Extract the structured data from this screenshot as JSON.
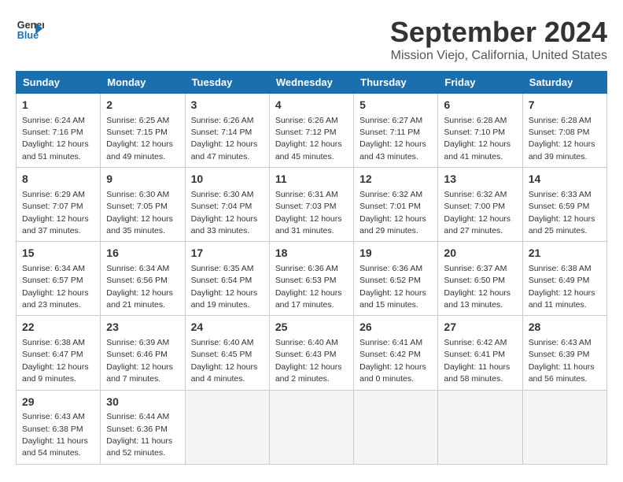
{
  "logo": {
    "line1": "General",
    "line2": "Blue"
  },
  "title": "September 2024",
  "subtitle": "Mission Viejo, California, United States",
  "headers": [
    "Sunday",
    "Monday",
    "Tuesday",
    "Wednesday",
    "Thursday",
    "Friday",
    "Saturday"
  ],
  "weeks": [
    [
      {
        "day": "1",
        "sunrise": "6:24 AM",
        "sunset": "7:16 PM",
        "daylight": "12 hours and 51 minutes."
      },
      {
        "day": "2",
        "sunrise": "6:25 AM",
        "sunset": "7:15 PM",
        "daylight": "12 hours and 49 minutes."
      },
      {
        "day": "3",
        "sunrise": "6:26 AM",
        "sunset": "7:14 PM",
        "daylight": "12 hours and 47 minutes."
      },
      {
        "day": "4",
        "sunrise": "6:26 AM",
        "sunset": "7:12 PM",
        "daylight": "12 hours and 45 minutes."
      },
      {
        "day": "5",
        "sunrise": "6:27 AM",
        "sunset": "7:11 PM",
        "daylight": "12 hours and 43 minutes."
      },
      {
        "day": "6",
        "sunrise": "6:28 AM",
        "sunset": "7:10 PM",
        "daylight": "12 hours and 41 minutes."
      },
      {
        "day": "7",
        "sunrise": "6:28 AM",
        "sunset": "7:08 PM",
        "daylight": "12 hours and 39 minutes."
      }
    ],
    [
      {
        "day": "8",
        "sunrise": "6:29 AM",
        "sunset": "7:07 PM",
        "daylight": "12 hours and 37 minutes."
      },
      {
        "day": "9",
        "sunrise": "6:30 AM",
        "sunset": "7:05 PM",
        "daylight": "12 hours and 35 minutes."
      },
      {
        "day": "10",
        "sunrise": "6:30 AM",
        "sunset": "7:04 PM",
        "daylight": "12 hours and 33 minutes."
      },
      {
        "day": "11",
        "sunrise": "6:31 AM",
        "sunset": "7:03 PM",
        "daylight": "12 hours and 31 minutes."
      },
      {
        "day": "12",
        "sunrise": "6:32 AM",
        "sunset": "7:01 PM",
        "daylight": "12 hours and 29 minutes."
      },
      {
        "day": "13",
        "sunrise": "6:32 AM",
        "sunset": "7:00 PM",
        "daylight": "12 hours and 27 minutes."
      },
      {
        "day": "14",
        "sunrise": "6:33 AM",
        "sunset": "6:59 PM",
        "daylight": "12 hours and 25 minutes."
      }
    ],
    [
      {
        "day": "15",
        "sunrise": "6:34 AM",
        "sunset": "6:57 PM",
        "daylight": "12 hours and 23 minutes."
      },
      {
        "day": "16",
        "sunrise": "6:34 AM",
        "sunset": "6:56 PM",
        "daylight": "12 hours and 21 minutes."
      },
      {
        "day": "17",
        "sunrise": "6:35 AM",
        "sunset": "6:54 PM",
        "daylight": "12 hours and 19 minutes."
      },
      {
        "day": "18",
        "sunrise": "6:36 AM",
        "sunset": "6:53 PM",
        "daylight": "12 hours and 17 minutes."
      },
      {
        "day": "19",
        "sunrise": "6:36 AM",
        "sunset": "6:52 PM",
        "daylight": "12 hours and 15 minutes."
      },
      {
        "day": "20",
        "sunrise": "6:37 AM",
        "sunset": "6:50 PM",
        "daylight": "12 hours and 13 minutes."
      },
      {
        "day": "21",
        "sunrise": "6:38 AM",
        "sunset": "6:49 PM",
        "daylight": "12 hours and 11 minutes."
      }
    ],
    [
      {
        "day": "22",
        "sunrise": "6:38 AM",
        "sunset": "6:47 PM",
        "daylight": "12 hours and 9 minutes."
      },
      {
        "day": "23",
        "sunrise": "6:39 AM",
        "sunset": "6:46 PM",
        "daylight": "12 hours and 7 minutes."
      },
      {
        "day": "24",
        "sunrise": "6:40 AM",
        "sunset": "6:45 PM",
        "daylight": "12 hours and 4 minutes."
      },
      {
        "day": "25",
        "sunrise": "6:40 AM",
        "sunset": "6:43 PM",
        "daylight": "12 hours and 2 minutes."
      },
      {
        "day": "26",
        "sunrise": "6:41 AM",
        "sunset": "6:42 PM",
        "daylight": "12 hours and 0 minutes."
      },
      {
        "day": "27",
        "sunrise": "6:42 AM",
        "sunset": "6:41 PM",
        "daylight": "11 hours and 58 minutes."
      },
      {
        "day": "28",
        "sunrise": "6:43 AM",
        "sunset": "6:39 PM",
        "daylight": "11 hours and 56 minutes."
      }
    ],
    [
      {
        "day": "29",
        "sunrise": "6:43 AM",
        "sunset": "6:38 PM",
        "daylight": "11 hours and 54 minutes."
      },
      {
        "day": "30",
        "sunrise": "6:44 AM",
        "sunset": "6:36 PM",
        "daylight": "11 hours and 52 minutes."
      },
      null,
      null,
      null,
      null,
      null
    ]
  ]
}
